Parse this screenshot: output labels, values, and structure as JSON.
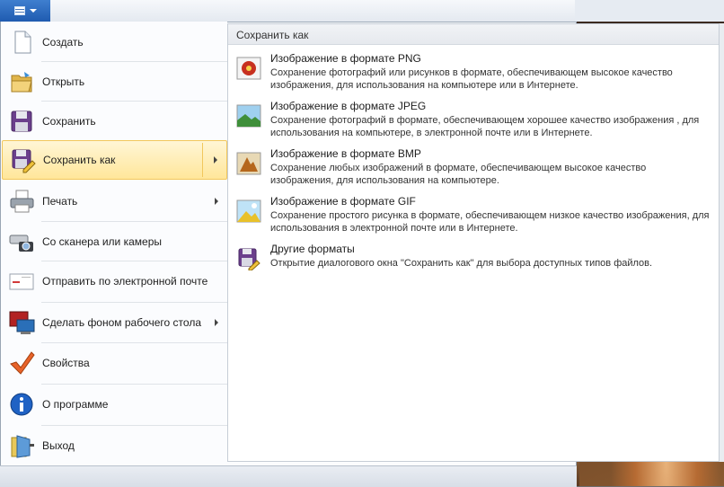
{
  "window": {
    "app_button_icon": "paint-menu-icon",
    "accent": "#2a66bf",
    "highlight": "#ffe69a"
  },
  "menu": {
    "items": [
      {
        "label": "Создать",
        "icon": "new-document-icon",
        "has_submenu": false
      },
      {
        "label": "Открыть",
        "icon": "open-folder-icon",
        "has_submenu": false
      },
      {
        "label": "Сохранить",
        "icon": "floppy-disk-icon",
        "has_submenu": false
      },
      {
        "label": "Сохранить как",
        "icon": "save-as-icon",
        "has_submenu": true
      },
      {
        "label": "Печать",
        "icon": "printer-icon",
        "has_submenu": true
      },
      {
        "label": "Со сканера или камеры",
        "icon": "scanner-camera-icon",
        "has_submenu": false
      },
      {
        "label": "Отправить по электронной почте",
        "icon": "email-icon",
        "has_submenu": false
      },
      {
        "label": "Сделать фоном рабочего стола",
        "icon": "desktop-background-icon",
        "has_submenu": true
      },
      {
        "label": "Свойства",
        "icon": "checkmark-icon",
        "has_submenu": false
      },
      {
        "label": "О программе",
        "icon": "info-icon",
        "has_submenu": false
      },
      {
        "label": "Выход",
        "icon": "exit-icon",
        "has_submenu": false
      }
    ]
  },
  "save_as": {
    "header": "Сохранить как",
    "formats": [
      {
        "title": "Изображение в формате PNG",
        "icon": "png-image-icon",
        "desc": "Сохранение фотографий или рисунков в формате, обеспечивающем высокое качество изображения, для использования на компьютере или в Интернете."
      },
      {
        "title": "Изображение в формате JPEG",
        "icon": "jpeg-image-icon",
        "desc": "Сохранение фотографий в формате, обеспечивающем хорошее качество изображения , для использования на компьютере, в электронной почте или в Интернете."
      },
      {
        "title": "Изображение в формате BMP",
        "icon": "bmp-image-icon",
        "desc": "Сохранение любых изображений в формате, обеспечивающем высокое качество изображения, для использования на компьютере."
      },
      {
        "title": "Изображение в формате GIF",
        "icon": "gif-image-icon",
        "desc": "Сохранение простого рисунка в формате, обеспечивающем низкое качество изображения, для использования в электронной почте или в Интернете."
      },
      {
        "title": "Другие форматы",
        "icon": "other-formats-icon",
        "desc": "Открытие диалогового окна \"Сохранить как\" для выбора доступных типов файлов."
      }
    ]
  }
}
